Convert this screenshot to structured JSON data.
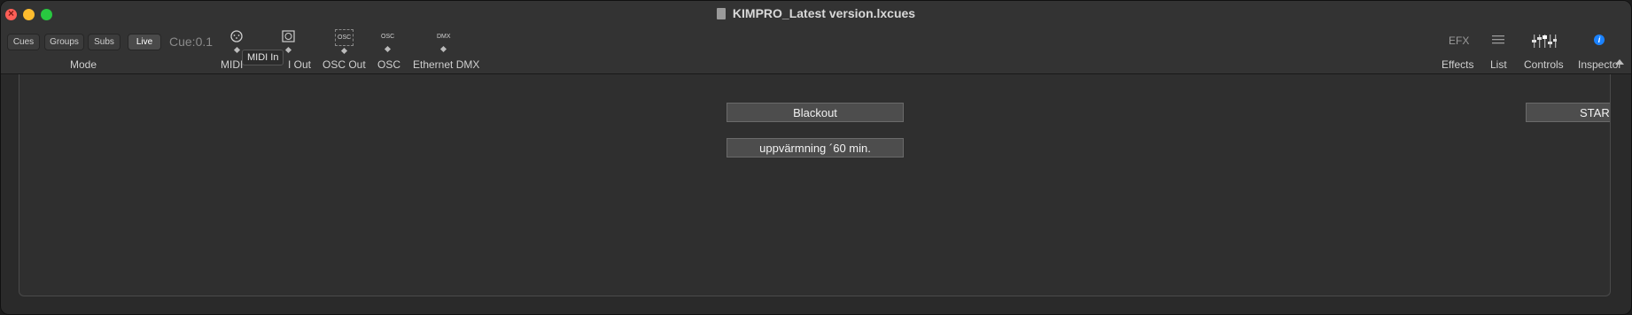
{
  "window": {
    "title": "KIMPRO_Latest version.lxcues"
  },
  "mode": {
    "segments": [
      "Cues",
      "Groups",
      "Subs",
      "Live"
    ],
    "active": "Live",
    "label": "Mode",
    "cue_indicator": "Cue:0.1"
  },
  "toolbar_left": {
    "midi_in_label": "MIDI",
    "midi_out_label": "I Out",
    "osc_out_label": "OSC Out",
    "osc_label": "OSC",
    "ethernet_dmx_label": "Ethernet DMX",
    "osc_glyph": "OSC",
    "dmx_glyph": "DMX",
    "tooltip": "MIDI In"
  },
  "toolbar_right": {
    "efx_glyph": "EFX",
    "effects_label": "Effects",
    "list_label": "List",
    "controls_label": "Controls",
    "inspector_label": "Inspector"
  },
  "cue_buttons": [
    {
      "label": "Blackout"
    },
    {
      "label": "uppvärmning ´60 min."
    },
    {
      "label": "STAR"
    }
  ],
  "colors": {
    "window_bg": "#2a2a2a",
    "button_bg": "#4d4d4d",
    "accent_info": "#1a82ff"
  }
}
